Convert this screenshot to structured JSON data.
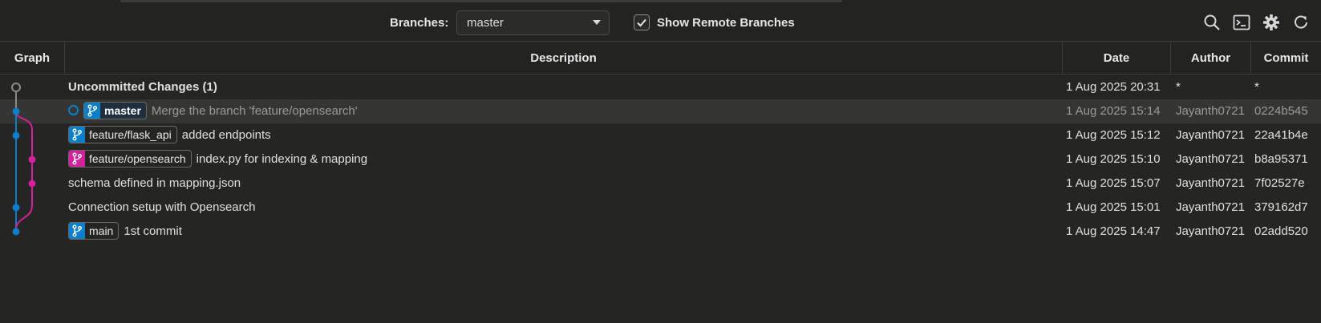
{
  "toolbar": {
    "branches_label": "Branches:",
    "branch_selected": "master",
    "show_remote_label": "Show Remote Branches",
    "show_remote_checked": true,
    "icons": [
      "search-icon",
      "terminal-icon",
      "gear-icon",
      "refresh-icon"
    ]
  },
  "columns": {
    "graph": "Graph",
    "description": "Description",
    "date": "Date",
    "author": "Author",
    "commit": "Commit"
  },
  "colors": {
    "blue_branch": "#0d7ec9",
    "pink_branch": "#d3209b",
    "uncommitted": "#8a8a88"
  },
  "rows": [
    {
      "description": "Uncommitted Changes (1)",
      "date": "1 Aug 2025 20:31",
      "author": "*",
      "commit": "*"
    },
    {
      "ref": "master",
      "description": "Merge the branch 'feature/opensearch'",
      "date": "1 Aug 2025 15:14",
      "author": "Jayanth0721",
      "commit": "0224b545"
    },
    {
      "ref": "feature/flask_api",
      "description": "added endpoints",
      "date": "1 Aug 2025 15:12",
      "author": "Jayanth0721",
      "commit": "22a41b4e"
    },
    {
      "ref": "feature/opensearch",
      "description": "index.py for indexing & mapping",
      "date": "1 Aug 2025 15:10",
      "author": "Jayanth0721",
      "commit": "b8a95371"
    },
    {
      "description": "schema defined in mapping.json",
      "date": "1 Aug 2025 15:07",
      "author": "Jayanth0721",
      "commit": "7f02527e"
    },
    {
      "description": "Connection setup with Opensearch",
      "date": "1 Aug 2025 15:01",
      "author": "Jayanth0721",
      "commit": "379162d7"
    },
    {
      "ref": "main",
      "description": "1st commit",
      "date": "1 Aug 2025 14:47",
      "author": "Jayanth0721",
      "commit": "02add520"
    }
  ]
}
